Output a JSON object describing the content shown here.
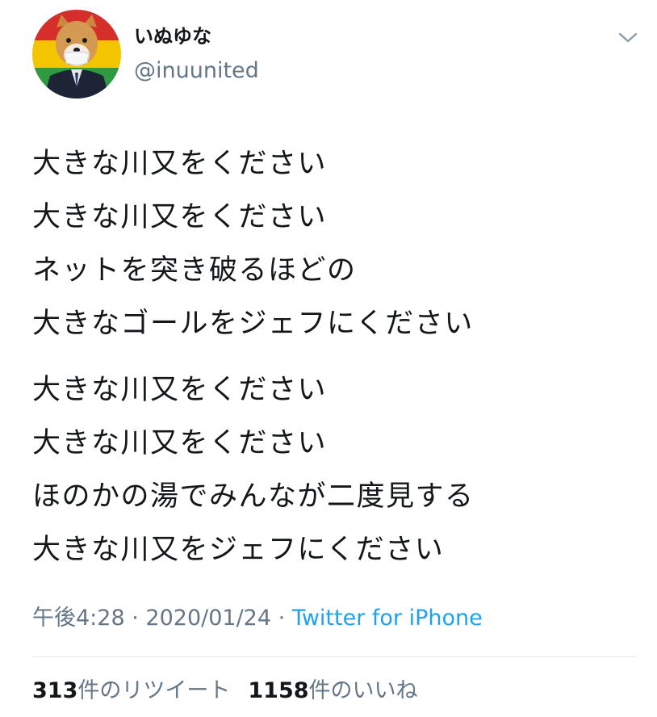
{
  "user": {
    "display_name": "いぬゆな",
    "handle": "@inuunited"
  },
  "tweet": {
    "stanzas": [
      [
        "大きな川又をください",
        "大きな川又をください",
        "ネットを突き破るほどの",
        "大きなゴールをジェフにください"
      ],
      [
        "大きな川又をください",
        "大きな川又をください",
        "ほのかの湯でみんなが二度見する",
        "大きな川又をジェフにください"
      ]
    ],
    "time": "午後4:28",
    "date": "2020/01/24",
    "separator": "·",
    "source": "Twitter for iPhone"
  },
  "stats": {
    "retweet_count": "313",
    "retweet_label": "件のリツイート",
    "like_count": "1158",
    "like_label": "件のいいね"
  },
  "icons": {
    "menu": "chevron-down-icon",
    "avatar": "shiba-inu-avatar"
  },
  "colors": {
    "text": "#14171a",
    "secondary": "#657786",
    "link": "#1da1f2",
    "divider": "#e1e8ed",
    "avatar_stripes": [
      "#d62f2b",
      "#f2c500",
      "#2f9a3f"
    ]
  }
}
